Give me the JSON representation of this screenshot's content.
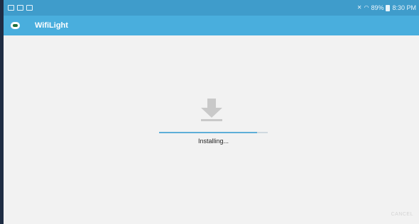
{
  "status_bar": {
    "battery": "89%",
    "time": "8:30 PM"
  },
  "app_bar": {
    "title": "WifiLight",
    "icon": "android-app-icon"
  },
  "installer": {
    "icon": "download-icon",
    "status": "Installing...",
    "progress": 0.9,
    "cancel_label": "CANCEL"
  },
  "colors": {
    "status_bar": "#3f9ccb",
    "app_bar": "#49aedd",
    "background": "#f2f2f2",
    "progress_fill": "#5eaed8",
    "icon_gray": "#c9c9c9"
  }
}
